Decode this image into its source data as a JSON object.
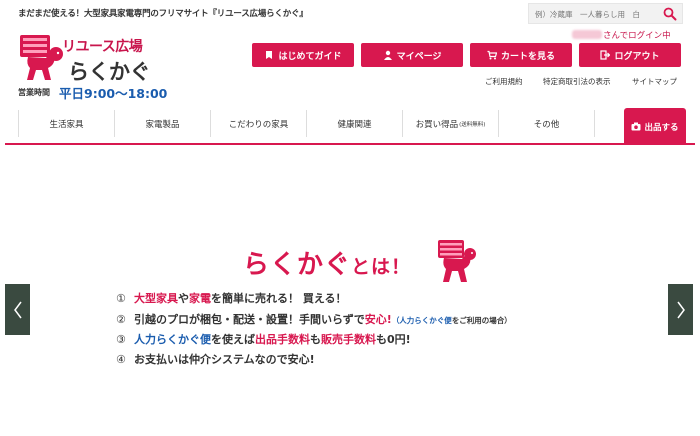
{
  "header": {
    "tagline": "まだまだ使える！大型家具家電専門のフリマサイト『リユース広場らくかぐ』",
    "search_placeholder": "例）冷蔵庫　一人暮らし用　白",
    "logo_small": "リユース広場",
    "logo_main": "らくかぐ",
    "hours_label": "営業時間",
    "hours_value": "平日9:00〜18:00",
    "login_suffix": "さんでログイン中"
  },
  "buttons": {
    "guide": "はじめてガイド",
    "mypage": "マイページ",
    "cart": "カートを見る",
    "logout": "ログアウト"
  },
  "sublinks": {
    "terms": "ご利用規約",
    "law": "特定商取引法の表示",
    "sitemap": "サイトマップ"
  },
  "nav": {
    "items": [
      "生活家具",
      "家電製品",
      "こだわりの家具",
      "健康関連",
      "お買い得品",
      "その他"
    ],
    "deal_note": "(送料無料)",
    "sell": "出品する"
  },
  "hero": {
    "title_main": "らくかぐ",
    "title_suffix": "とは！",
    "points": [
      {
        "num": "①",
        "parts": [
          "大型家具",
          "や",
          "家電",
          "を簡単に売れる！ 買える！"
        ]
      },
      {
        "num": "②",
        "parts": [
          "引越のプロが梱包・配送・設置！手間いらずで",
          "安心!",
          "（人力らくかぐ便",
          "をご利用の場合）"
        ]
      },
      {
        "num": "③",
        "parts": [
          "人力らくかぐ便",
          "を使えば",
          "出品手数料",
          "も",
          "販売手数料",
          "も0円!"
        ]
      },
      {
        "num": "④",
        "parts": [
          "お支払いは仲介システムなので安心!"
        ]
      }
    ]
  },
  "colors": {
    "brand": "#d8184f",
    "blue": "#1a5cae",
    "arrow_bg": "#3a4a40"
  }
}
